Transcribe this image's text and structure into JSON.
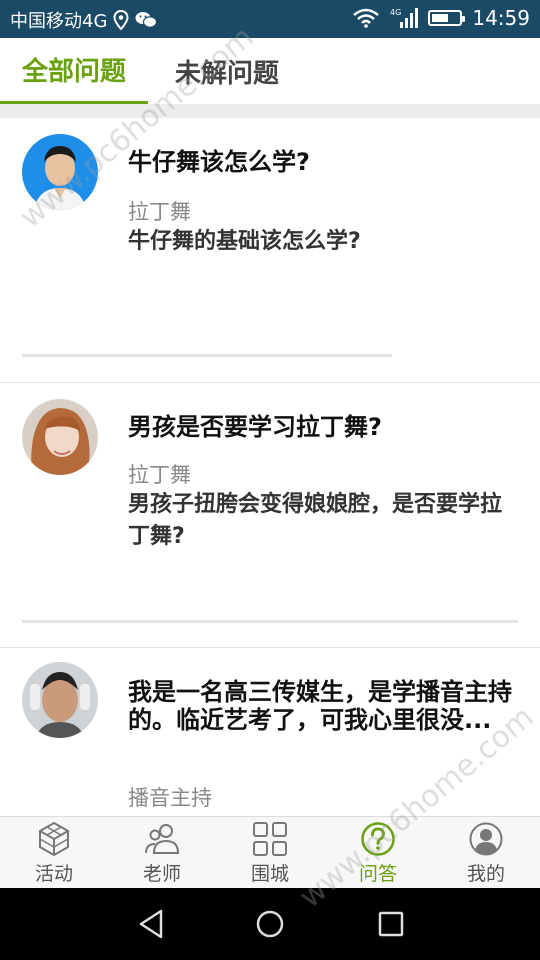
{
  "status_bar": {
    "carrier": "中国移动4G",
    "network": "4G",
    "time": "14:59",
    "battery_level": 0.6
  },
  "tabs": [
    {
      "label": "全部问题",
      "active": true
    },
    {
      "label": "未解问题",
      "active": false
    }
  ],
  "questions": [
    {
      "title": "牛仔舞该怎么学?",
      "category": "拉丁舞",
      "description": "牛仔舞的基础该怎么学?"
    },
    {
      "title": "男孩是否要学习拉丁舞?",
      "category": "拉丁舞",
      "description": "男孩子扭胯会变得娘娘腔，是否要学拉丁舞?"
    },
    {
      "title": "我是一名高三传媒生，是学播音主持的。临近艺考了，可我心里很没...",
      "category": "播音主持",
      "description": ""
    }
  ],
  "bottom_nav": [
    {
      "label": "活动",
      "icon": "cube-icon",
      "active": false
    },
    {
      "label": "老师",
      "icon": "people-icon",
      "active": false
    },
    {
      "label": "围城",
      "icon": "grid-icon",
      "active": false
    },
    {
      "label": "问答",
      "icon": "question-icon",
      "active": true
    },
    {
      "label": "我的",
      "icon": "profile-icon",
      "active": false
    }
  ],
  "watermark": "www.pc6home.com",
  "colors": {
    "accent": "#6aa10f",
    "status_bar": "#1a4a66"
  }
}
